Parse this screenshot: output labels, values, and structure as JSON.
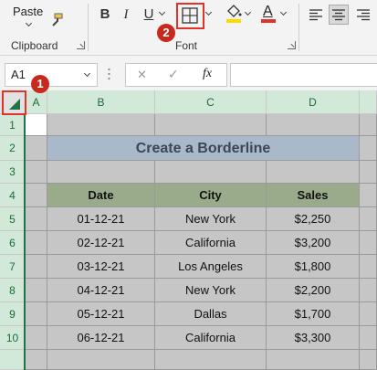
{
  "ribbon": {
    "clipboard": {
      "paste_label": "Paste",
      "group_label": "Clipboard"
    },
    "font": {
      "group_label": "Font",
      "bold_label": "B",
      "italic_label": "I",
      "underline_label": "U",
      "font_color_letter": "A",
      "highlight_color": "#ffd800",
      "font_color": "#e0342a"
    }
  },
  "formula_bar": {
    "name_box": "A1",
    "cancel_icon": "✕",
    "enter_icon": "✓",
    "fx_label": "fx",
    "value": ""
  },
  "grid": {
    "select_all_icon": "select-all-triangle",
    "columns": [
      "A",
      "B",
      "C",
      "D"
    ],
    "rows": [
      "1",
      "2",
      "3",
      "4",
      "5",
      "6",
      "7",
      "8",
      "9",
      "10"
    ],
    "title": "Create a Borderline",
    "table_headers": [
      "Date",
      "City",
      "Sales"
    ],
    "table_rows": [
      [
        "01-12-21",
        "New York",
        "$2,250"
      ],
      [
        "02-12-21",
        "California",
        "$3,200"
      ],
      [
        "03-12-21",
        "Los Angeles",
        "$1,800"
      ],
      [
        "04-12-21",
        "New York",
        "$2,200"
      ],
      [
        "05-12-21",
        "Dallas",
        "$1,700"
      ],
      [
        "06-12-21",
        "California",
        "$3,300"
      ]
    ]
  },
  "annotations": {
    "step1": "1",
    "step2": "2",
    "color": "#e0342a"
  }
}
